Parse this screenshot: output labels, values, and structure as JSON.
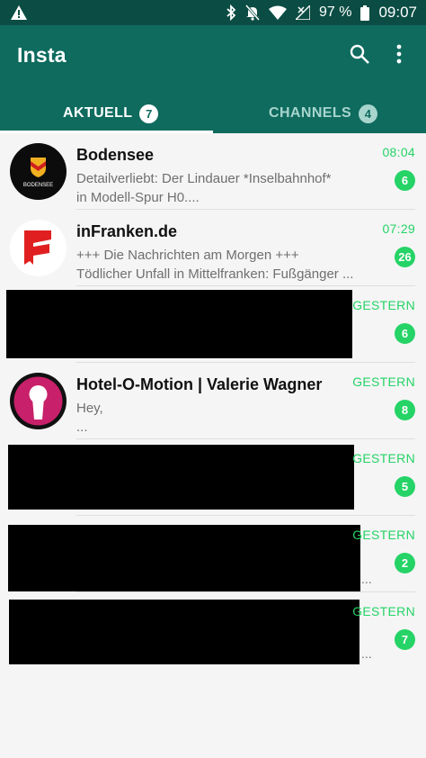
{
  "status_bar": {
    "battery": "97 %",
    "time": "09:07",
    "icons": [
      "warning-icon",
      "bluetooth-icon",
      "notifications-off-icon",
      "wifi-icon",
      "signal-off-icon",
      "battery-icon"
    ]
  },
  "app": {
    "title": "Insta",
    "actions": [
      "search-icon",
      "more-vert-icon"
    ]
  },
  "tabs": [
    {
      "label": "AKTUELL",
      "badge": "7",
      "active": true
    },
    {
      "label": "CHANNELS",
      "badge": "4",
      "active": false
    }
  ],
  "chats": [
    {
      "name": "Bodensee",
      "line1": "Detailverliebt: Der Lindauer *Inselbahnhof*",
      "line2": "in Modell-Spur H0....",
      "time": "08:04",
      "unread": "6",
      "avatar": "bodensee-logo",
      "avatar_text": "BODENSEE"
    },
    {
      "name": "inFranken.de",
      "line1": "+++ Die Nachrichten am Morgen +++",
      "line2": "Tödlicher Unfall in Mittelfranken: Fußgänger ...",
      "time": "07:29",
      "unread": "26",
      "avatar": "infranken-logo"
    },
    {
      "name": "",
      "time": "GESTERN",
      "unread": "6",
      "redacted": true
    },
    {
      "name": "Hotel-O-Motion | Valerie Wagner",
      "line1": "Hey,",
      "line2": "...",
      "time": "GESTERN",
      "unread": "8",
      "avatar": "keyhole-logo"
    },
    {
      "name": "",
      "time": "GESTERN",
      "unread": "5",
      "redacted": true
    },
    {
      "name": "",
      "time": "GESTERN",
      "unread": "2",
      "redacted": true,
      "trailing": "..."
    },
    {
      "name": "",
      "time": "GESTERN",
      "unread": "7",
      "redacted": true,
      "trailing": "..."
    }
  ],
  "colors": {
    "status_bar": "#0b4d44",
    "app_bar": "#0e6b5e",
    "accent_green": "#25d366",
    "inactive_tab": "#a7d5ce"
  }
}
